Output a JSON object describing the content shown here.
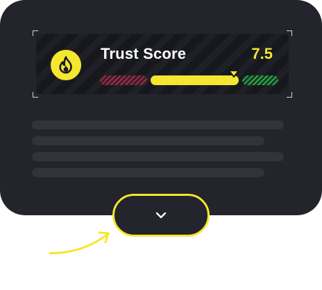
{
  "trust_score": {
    "title": "Trust Score",
    "value": "7.5",
    "level_fraction": 0.75,
    "icon": "flame-icon",
    "colors": {
      "accent": "#f5e62f",
      "low": "#9c2f49",
      "high": "#2fa84a"
    }
  },
  "content_placeholder": {
    "line_count": 4
  },
  "expand_toggle": {
    "icon": "chevron-down-icon"
  },
  "hint_arrow": {
    "icon": "curved-arrow-icon",
    "color": "#f5e62f"
  }
}
